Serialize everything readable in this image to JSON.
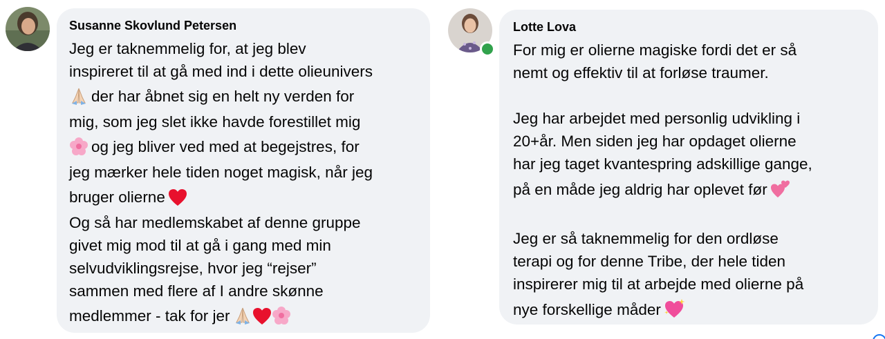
{
  "comments": [
    {
      "author": "Susanne Skovlund Petersen",
      "lines": [
        "Jeg er taknemmelig for, at jeg blev",
        "inspireret til at gå med ind i dette olieunivers",
        "der har åbnet sig en helt ny verden for",
        "mig, som jeg slet ikke havde forestillet mig",
        "og jeg bliver ved med at begejstres, for",
        "jeg mærker hele tiden noget magisk, når jeg",
        "bruger olierne",
        "Og så har medlemskabet af denne gruppe",
        "givet mig mod til at gå i gang med min",
        "selvudviklingsrejse, hvor jeg “rejser”",
        "sammen med flere af I andre skønne",
        "medlemmer - tak for jer"
      ],
      "avatar_icon": "profile-photo-woman",
      "emojis": [
        "folded-hands-icon",
        "cherry-blossom-icon",
        "red-heart-icon",
        "folded-hands-icon",
        "red-heart-icon",
        "cherry-blossom-icon"
      ]
    },
    {
      "author": "Lotte Lova",
      "lines": [
        "For mig er olierne magiske fordi det er så",
        "nemt og effektiv til at forløse traumer.",
        "Jeg har arbejdet med personlig udvikling i",
        "20+år. Men siden jeg har opdaget olierne",
        "har jeg taget kvantespring adskillige gange,",
        "på en måde jeg aldrig har oplevet før",
        "Jeg er så taknemmelig for den ordløse",
        "terapi og for denne Tribe, der hele tiden",
        "inspirerer mig til at arbejde med olierne på",
        "nye forskellige måder"
      ],
      "avatar_icon": "profile-photo-woman",
      "online_status": "online",
      "emojis": [
        "two-hearts-icon",
        "sparkling-heart-icon"
      ]
    }
  ],
  "colors": {
    "bubble_bg": "#f0f2f5",
    "text": "#050505",
    "online": "#31a24c",
    "heart": "#e0245e",
    "blossom": "#f7a8c8"
  }
}
